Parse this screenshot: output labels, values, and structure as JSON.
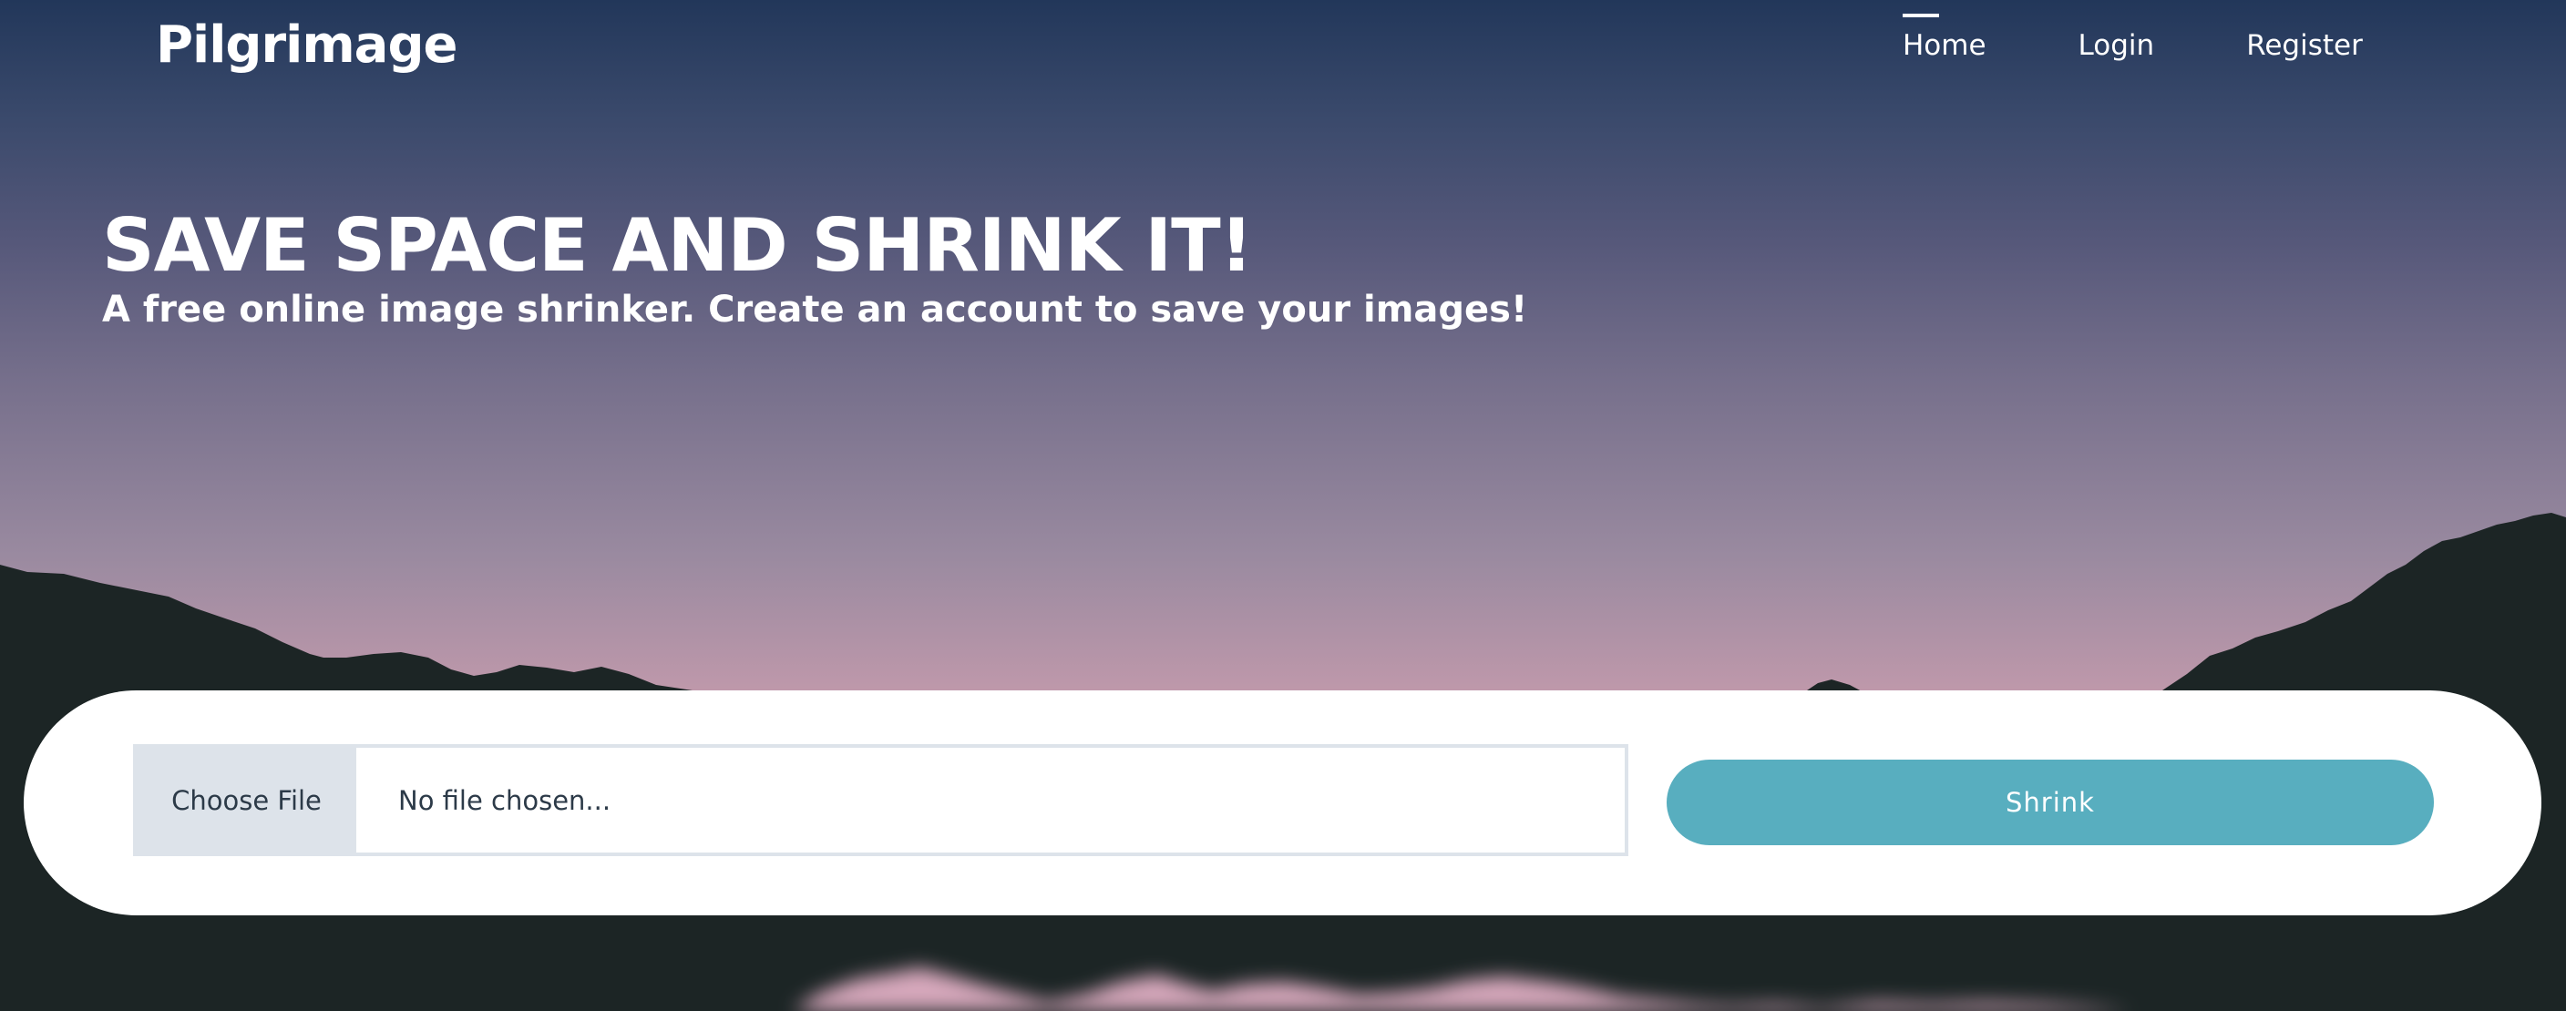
{
  "brand": {
    "name": "Pilgrimage"
  },
  "nav": {
    "items": [
      {
        "label": "Home",
        "active": true
      },
      {
        "label": "Login",
        "active": false
      },
      {
        "label": "Register",
        "active": false
      }
    ]
  },
  "hero": {
    "title": "SAVE SPACE AND SHRINK IT!",
    "subtitle": "A free online image shrinker. Create an account to save your images!"
  },
  "upload": {
    "choose_label": "Choose File",
    "file_status": "No file chosen...",
    "submit_label": "Shrink"
  },
  "colors": {
    "sky_top": "#22375a",
    "sky_bottom": "#cfa3b4",
    "mountains": "#1c2525",
    "accent": "#58aebf",
    "input_border": "#dde3ea"
  }
}
